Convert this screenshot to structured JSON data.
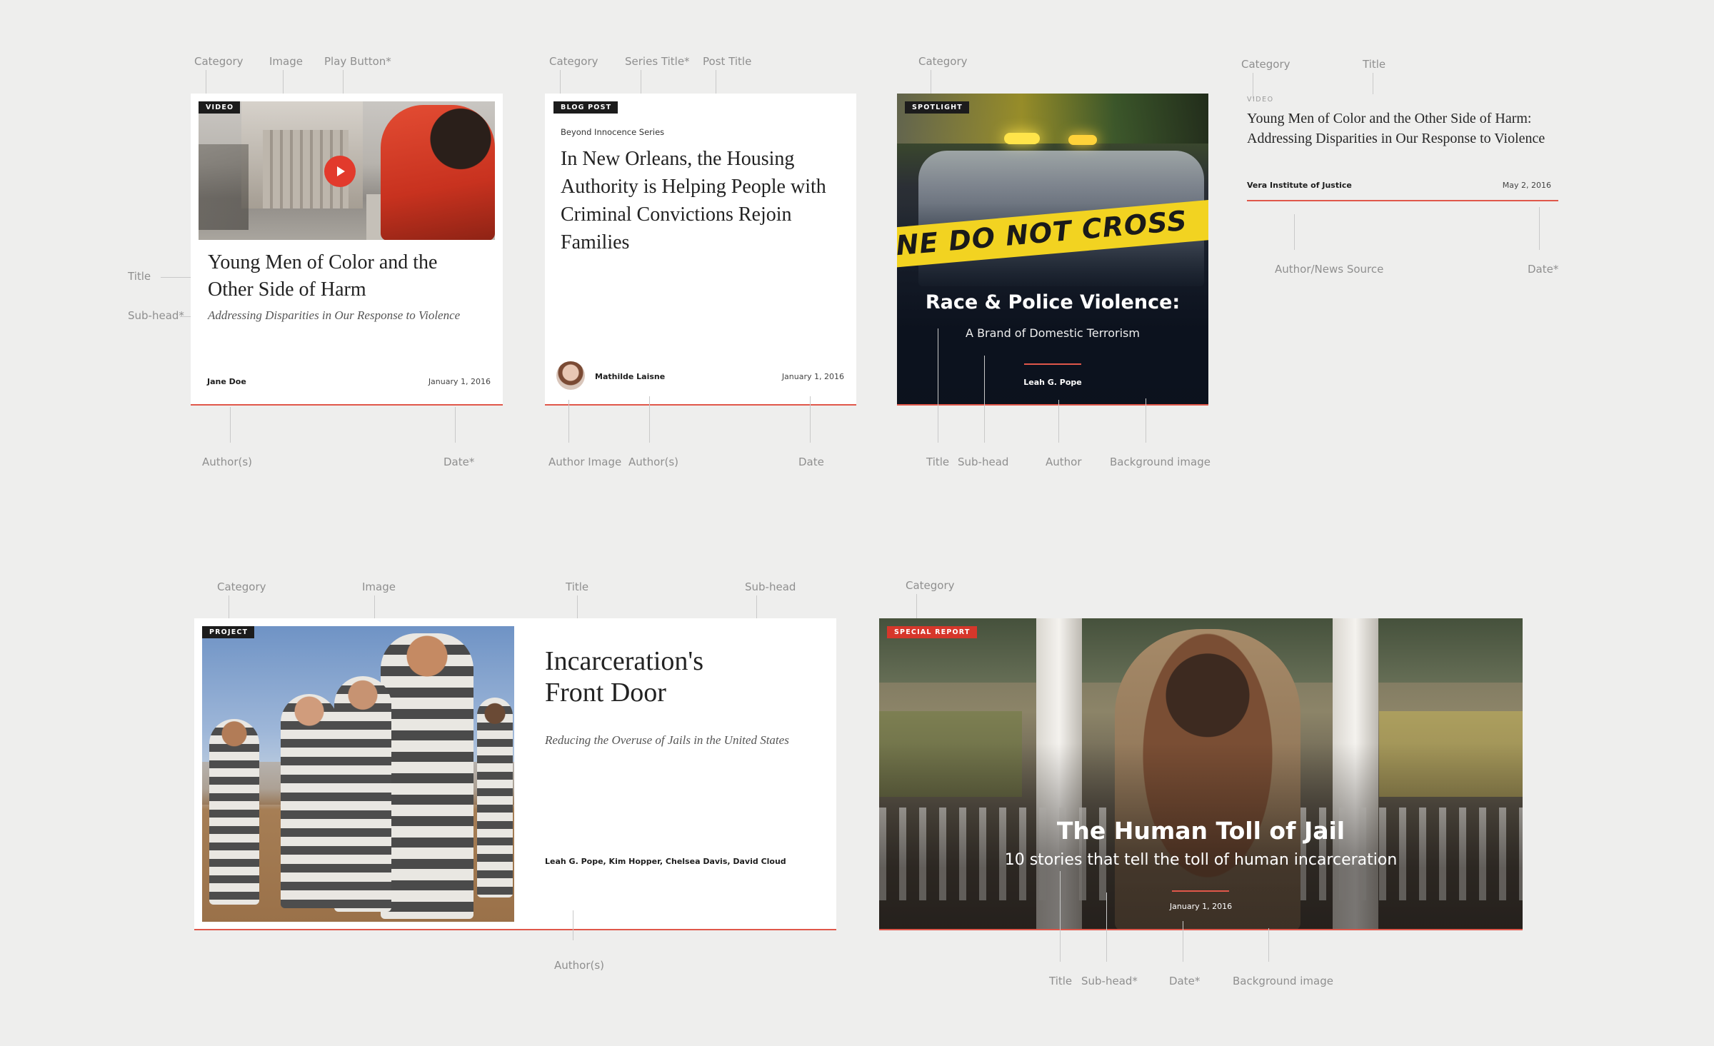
{
  "annotations": {
    "c1_category": "Category",
    "c1_image": "Image",
    "c1_play": "Play Button*",
    "c1_title": "Title",
    "c1_subhead": "Sub-head*",
    "c1_authors": "Author(s)",
    "c1_date": "Date*",
    "c2_category": "Category",
    "c2_series": "Series Title*",
    "c2_post_title": "Post Title",
    "c2_author_image": "Author Image",
    "c2_authors": "Author(s)",
    "c2_date": "Date",
    "c3_category": "Category",
    "c3_title": "Title",
    "c3_subhead": "Sub-head",
    "c3_author": "Author",
    "c3_bg": "Background image",
    "c4_category": "Category",
    "c4_title": "Title",
    "c4_source": "Author/News Source",
    "c4_date": "Date*",
    "c5_category": "Category",
    "c5_image": "Image",
    "c5_title": "Title",
    "c5_subhead": "Sub-head",
    "c5_authors": "Author(s)",
    "c6_category": "Category",
    "c6_title": "Title",
    "c6_subhead": "Sub-head*",
    "c6_date": "Date*",
    "c6_bg": "Background image"
  },
  "video_card": {
    "badge": "VIDEO",
    "title": "Young Men of Color and the Other Side of Harm",
    "subhead": "Addressing Disparities in Our Response to Violence",
    "author": "Jane Doe",
    "date": "January 1, 2016"
  },
  "blog_card": {
    "badge": "BLOG POST",
    "series": "Beyond Innocence Series",
    "title": "In New Orleans, the Housing Authority is Helping People with Criminal Convictions Rejoin Families",
    "author": "Mathilde Laisne",
    "date": "January 1, 2016"
  },
  "spotlight_card": {
    "badge": "SPOTLIGHT",
    "tape_text": "NE DO NOT CROSS",
    "title": "Race & Police Violence:",
    "subhead": "A Brand of Domestic Terrorism",
    "author": "Leah G. Pope"
  },
  "text_card": {
    "category": "VIDEO",
    "title": "Young Men of Color and the Other Side of Harm: Addressing Disparities in Our Response to Violence",
    "source": "Vera Institute of Justice",
    "date": "May 2, 2016"
  },
  "project_card": {
    "badge": "PROJECT",
    "title": "Incarceration's Front Door",
    "subhead": "Reducing the Overuse of Jails in the United States",
    "authors": "Leah G. Pope, Kim Hopper, Chelsea Davis, David Cloud"
  },
  "special_card": {
    "badge": "SPECIAL REPORT",
    "title": "The Human Toll of Jail",
    "subhead": "10 stories that tell the toll of human incarceration",
    "date": "January 1, 2016"
  },
  "colors": {
    "accent": "#e0574a",
    "badge_dark": "#1c1c1c",
    "badge_red": "#d6372b",
    "background": "#eeeeed"
  },
  "icons": [
    "play-icon"
  ]
}
